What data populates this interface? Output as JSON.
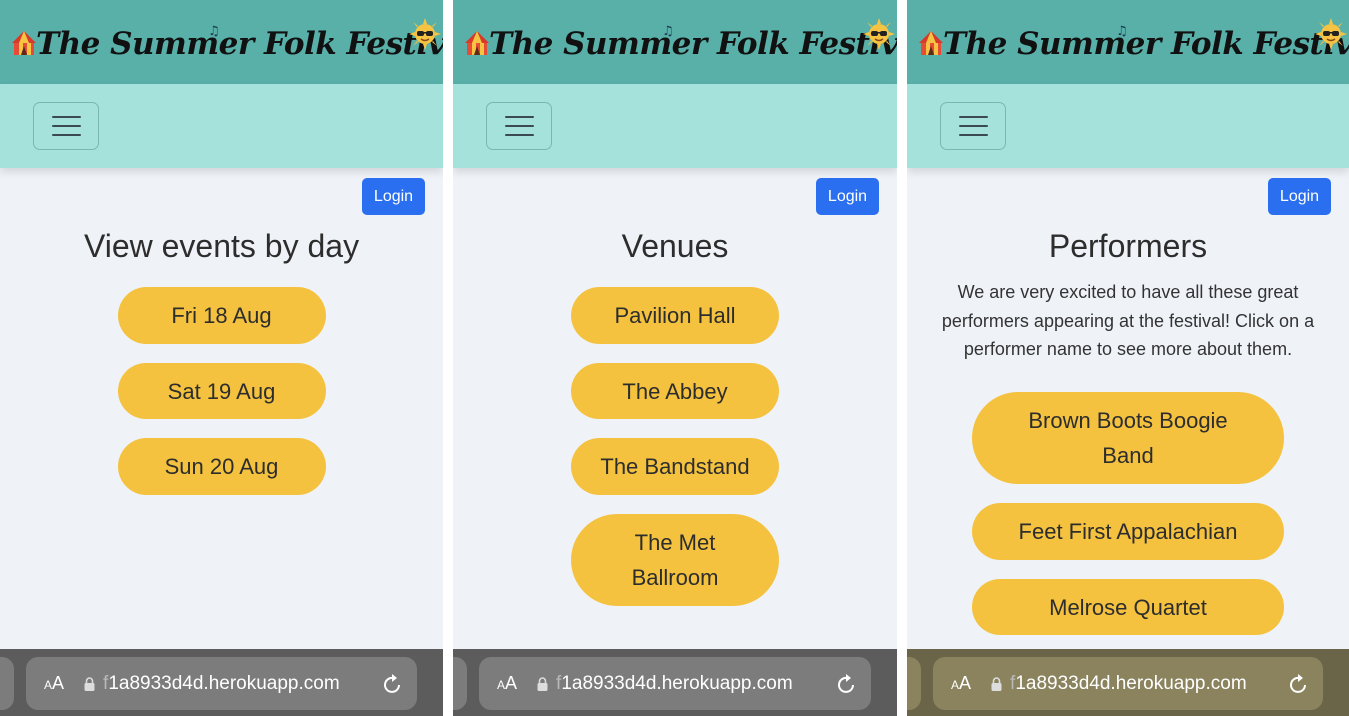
{
  "site": {
    "title": "The Summer Folk Festival",
    "login_label": "Login",
    "url_prefix": "f",
    "url": "1a8933d4d.herokuapp.com",
    "reader_label": "AA",
    "colors": {
      "header": "#58b0a9",
      "nav": "#a4e2db",
      "pill": "#f4c23f",
      "login": "#2a6ff0",
      "background": "#eff3f8"
    },
    "icons": [
      "circus-tent-icon",
      "music-note-icon",
      "sunglasses-sun-icon",
      "hamburger-menu-icon",
      "lock-icon",
      "reload-icon"
    ]
  },
  "panels": [
    {
      "heading": "View events by day",
      "items": [
        "Fri 18 Aug",
        "Sat 19 Aug",
        "Sun 20 Aug"
      ]
    },
    {
      "heading": "Venues",
      "items": [
        "Pavilion Hall",
        "The Abbey",
        "The Bandstand",
        "The Met Ballroom"
      ]
    },
    {
      "heading": "Performers",
      "intro": "We are very excited to have all these great performers appearing at the festival! Click on a performer name to see more about them.",
      "items": [
        "Brown Boots Boogie Band",
        "Feet First Appalachian",
        "Melrose Quartet"
      ]
    }
  ]
}
